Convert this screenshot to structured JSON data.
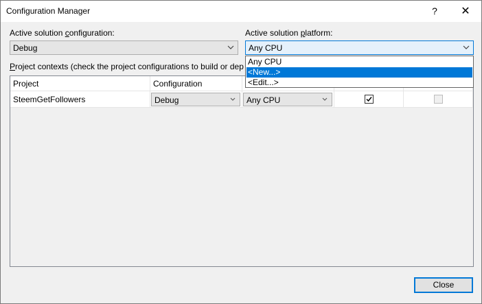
{
  "window": {
    "title": "Configuration Manager",
    "help_label": "?",
    "close_label": "✕"
  },
  "solution_configuration": {
    "label_pre": "Active solution ",
    "label_ul": "c",
    "label_post": "onfiguration:",
    "value": "Debug"
  },
  "solution_platform": {
    "label_pre": "Active solution ",
    "label_ul": "p",
    "label_post": "latform:",
    "value": "Any CPU",
    "dropdown_options": [
      "Any CPU",
      "<New...>",
      "<Edit...>"
    ],
    "selected_option_index": 1
  },
  "project_contexts": {
    "label_ul": "P",
    "label_post": "roject contexts (check the project configurations to build or dep"
  },
  "grid": {
    "columns": [
      "Project",
      "Configuration",
      "",
      "",
      ""
    ],
    "rows": [
      {
        "project": "SteemGetFollowers",
        "configuration": "Debug",
        "platform": "Any CPU",
        "build_checked": true,
        "deploy_enabled": false
      }
    ]
  },
  "close_button_label": "Close"
}
